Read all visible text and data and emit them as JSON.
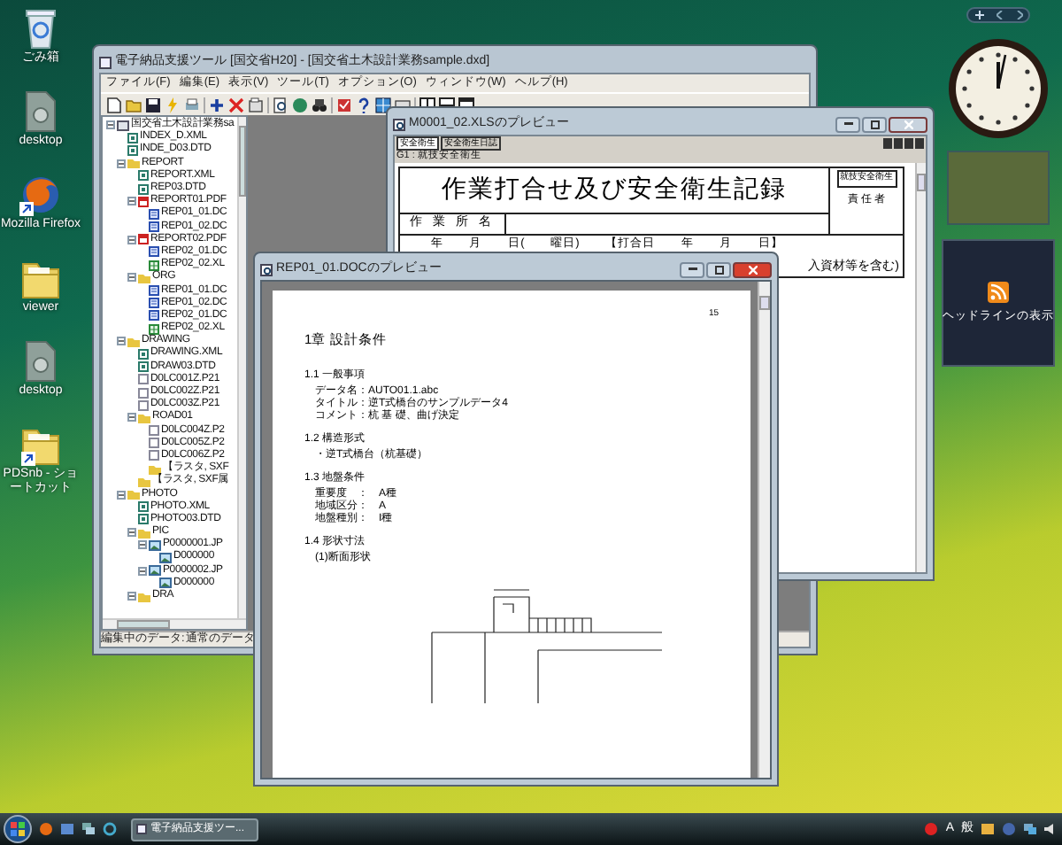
{
  "desktop_icons": [
    {
      "label": "ごみ箱",
      "kind": "trash",
      "shortcut": false
    },
    {
      "label": "desktop",
      "kind": "file",
      "shortcut": false
    },
    {
      "label": "Mozilla Firefox",
      "kind": "browser",
      "shortcut": true
    },
    {
      "label": "viewer",
      "kind": "folder",
      "shortcut": false
    },
    {
      "label": "desktop",
      "kind": "file",
      "shortcut": false
    },
    {
      "label": "PDSnb - ショートカット",
      "kind": "folder",
      "shortcut": true
    }
  ],
  "main_window": {
    "title": "電子納品支援ツール [国交省H20] - [国交省土木設計業務sample.dxd]",
    "menu": [
      "ファイル(F)",
      "編集(E)",
      "表示(V)",
      "ツール(T)",
      "オプション(O)",
      "ウィンドウ(W)",
      "ヘルプ(H)"
    ],
    "tree": [
      {
        "label": "国交省土木設計業務sa",
        "kind": "project",
        "expanded": true,
        "children": [
          {
            "label": "INDEX_D.XML",
            "kind": "xml"
          },
          {
            "label": "INDE_D03.DTD",
            "kind": "xml"
          },
          {
            "label": "REPORT",
            "kind": "folder",
            "expanded": true,
            "children": [
              {
                "label": "REPORT.XML",
                "kind": "xml"
              },
              {
                "label": "REP03.DTD",
                "kind": "xml"
              },
              {
                "label": "REPORT01.PDF",
                "kind": "pdf",
                "expanded": true,
                "children": [
                  {
                    "label": "REP01_01.DC",
                    "kind": "doc"
                  },
                  {
                    "label": "REP01_02.DC",
                    "kind": "doc"
                  }
                ]
              },
              {
                "label": "REPORT02.PDF",
                "kind": "pdf",
                "expanded": true,
                "children": [
                  {
                    "label": "REP02_01.DC",
                    "kind": "doc"
                  },
                  {
                    "label": "REP02_02.XL",
                    "kind": "xls"
                  }
                ]
              },
              {
                "label": "ORG",
                "kind": "folder",
                "expanded": true,
                "children": [
                  {
                    "label": "REP01_01.DC",
                    "kind": "doc"
                  },
                  {
                    "label": "REP01_02.DC",
                    "kind": "doc"
                  },
                  {
                    "label": "REP02_01.DC",
                    "kind": "doc"
                  },
                  {
                    "label": "REP02_02.XL",
                    "kind": "xls"
                  }
                ]
              }
            ]
          },
          {
            "label": "DRAWING",
            "kind": "folder",
            "expanded": true,
            "children": [
              {
                "label": "DRAWING.XML",
                "kind": "xml"
              },
              {
                "label": "DRAW03.DTD",
                "kind": "xml"
              },
              {
                "label": "D0LC001Z.P21",
                "kind": "file"
              },
              {
                "label": "D0LC002Z.P21",
                "kind": "file"
              },
              {
                "label": "D0LC003Z.P21",
                "kind": "file"
              },
              {
                "label": "ROAD01",
                "kind": "folder",
                "expanded": true,
                "children": [
                  {
                    "label": "D0LC004Z.P2",
                    "kind": "file"
                  },
                  {
                    "label": "D0LC005Z.P2",
                    "kind": "file"
                  },
                  {
                    "label": "D0LC006Z.P2",
                    "kind": "file"
                  },
                  {
                    "label": "【ラスタ, SXF",
                    "kind": "folder"
                  }
                ]
              },
              {
                "label": "【ラスタ, SXF属",
                "kind": "folder"
              }
            ]
          },
          {
            "label": "PHOTO",
            "kind": "folder",
            "expanded": true,
            "children": [
              {
                "label": "PHOTO.XML",
                "kind": "xml"
              },
              {
                "label": "PHOTO03.DTD",
                "kind": "xml"
              },
              {
                "label": "PIC",
                "kind": "folder",
                "expanded": true,
                "children": [
                  {
                    "label": "P0000001.JP",
                    "kind": "image",
                    "expanded": true,
                    "children": [
                      {
                        "label": "D000000",
                        "kind": "image"
                      }
                    ]
                  },
                  {
                    "label": "P0000002.JP",
                    "kind": "image",
                    "expanded": true,
                    "children": [
                      {
                        "label": "D000000",
                        "kind": "image"
                      }
                    ]
                  }
                ]
              },
              {
                "label": "DRA",
                "kind": "folder",
                "expanded": true
              }
            ]
          }
        ]
      }
    ],
    "status": "編集中のデータ: 通常のデータ"
  },
  "sheet_window": {
    "title": "M0001_02.XLSのプレビュー",
    "tabs": [
      {
        "label": "安全衛生",
        "selected": true
      },
      {
        "label": "安全衛生日誌",
        "selected": false
      }
    ],
    "sheet_name": "G1 : 就技安全衛生",
    "heading": "作業打合せ及び安全衛生記録",
    "tag": "就技安全衛生",
    "responsible": "責 任 者",
    "site_label": "作 業 所 名",
    "date_row": [
      "年",
      "月",
      "日(",
      "曜日)",
      "【打合日",
      "年",
      "月",
      "日】"
    ],
    "note": "入資材等を含む)"
  },
  "doc_window": {
    "title": "REP01_01.DOCのプレビュー",
    "page_number": "15",
    "lines": [
      {
        "text": "1章 設計条件",
        "kind": "chapter"
      },
      {
        "text": "1.1 一般事項",
        "kind": "section"
      },
      {
        "text": "データ名：AUTO01.1.abc",
        "kind": "item"
      },
      {
        "text": "タイトル：逆T式橋台のサンプルデータ4",
        "kind": "item"
      },
      {
        "text": "コメント：杭 基 礎、曲げ決定",
        "kind": "item"
      },
      {
        "text": "1.2 構造形式",
        "kind": "section"
      },
      {
        "text": "・逆T式橋台（杭基礎）",
        "kind": "item"
      },
      {
        "text": "1.3 地盤条件",
        "kind": "section"
      },
      {
        "text": "重要度　：　A種",
        "kind": "item"
      },
      {
        "text": "地域区分：　A",
        "kind": "item"
      },
      {
        "text": "地盤種別：　I種",
        "kind": "item"
      },
      {
        "text": "1.4 形状寸法",
        "kind": "section"
      },
      {
        "text": "(1)断面形状",
        "kind": "item"
      }
    ]
  },
  "gadgets": {
    "feed_label": "ヘッドラインの表示"
  },
  "taskbar": {
    "task": "電子納品支援ツー...",
    "ime": [
      "A",
      "般"
    ]
  }
}
